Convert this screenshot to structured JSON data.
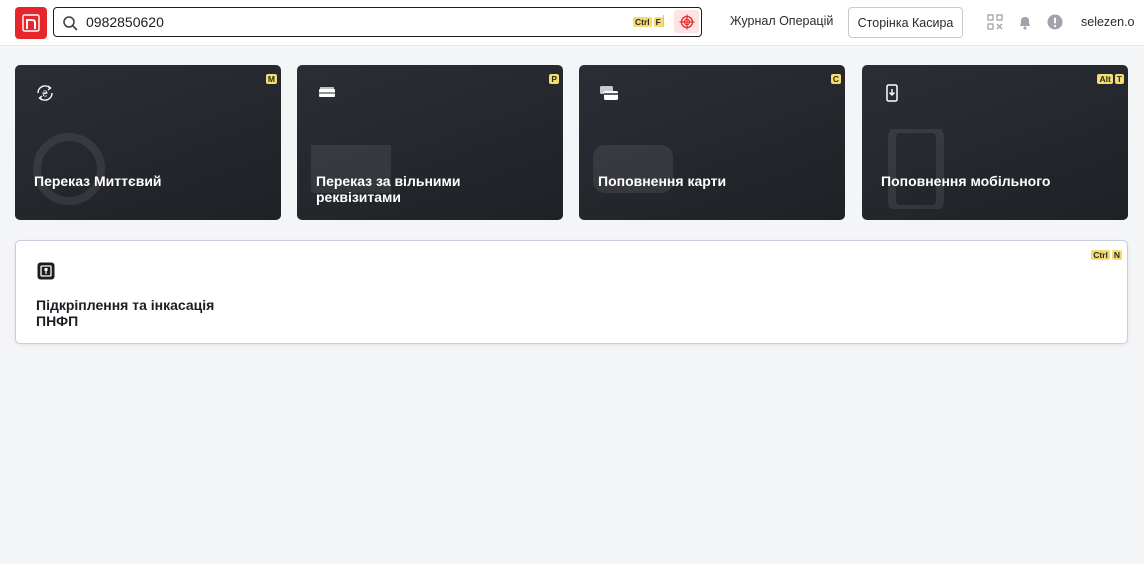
{
  "header": {
    "logo_icon": "brand-logo-icon",
    "search": {
      "value": "0982850620",
      "placeholder": "",
      "hotkey": [
        "Ctrl",
        "F"
      ],
      "scan_icon": "scan-target-icon"
    },
    "journal_link": "Журнал Операцій",
    "cashier_button": "Сторінка Касира",
    "icons": [
      "qr-code-icon",
      "bell-icon",
      "alert-icon"
    ],
    "username": "selezen.o"
  },
  "cards": [
    {
      "title": "Переказ Миттєвий",
      "hotkey": [
        "M"
      ],
      "icon": "instant-transfer-icon"
    },
    {
      "title": "Переказ за вільними реквізитами",
      "hotkey": [
        "P"
      ],
      "icon": "banknotes-icon"
    },
    {
      "title": "Поповнення карти",
      "hotkey": [
        "C"
      ],
      "icon": "cards-icon"
    },
    {
      "title": "Поповнення мобільного",
      "hotkey": [
        "Alt",
        "T"
      ],
      "icon": "mobile-topup-icon"
    }
  ],
  "wide_card": {
    "title": "Підкріплення та інкасація ПНФП",
    "hotkey": [
      "Ctrl",
      "N"
    ],
    "icon": "safe-icon"
  },
  "colors": {
    "brand_red": "#e5262b",
    "card_dark": "#24262c",
    "hotkey_yellow": "#f4dc6e",
    "page_bg": "#f4f5f7"
  }
}
